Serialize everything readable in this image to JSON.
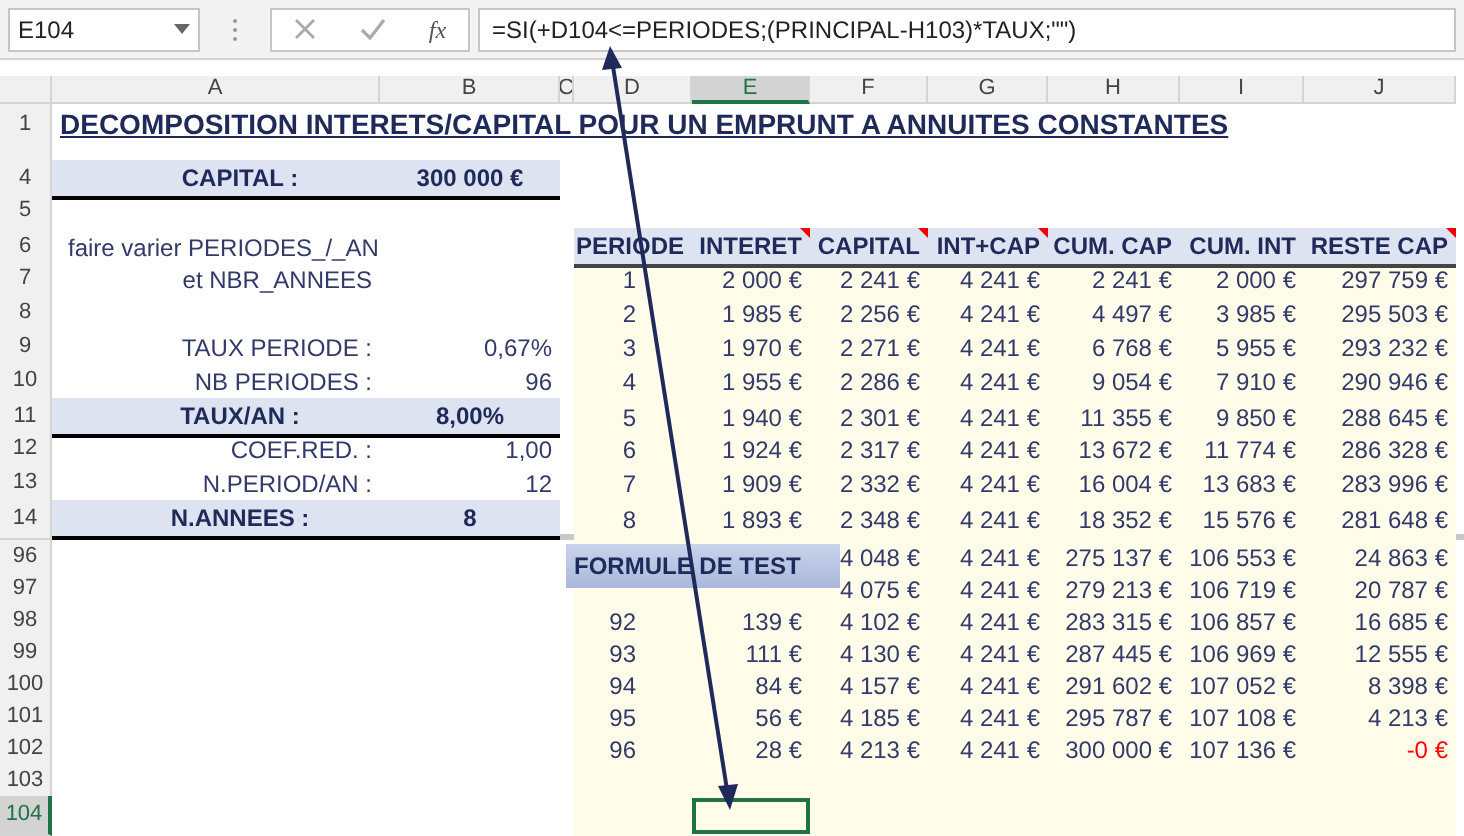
{
  "formula_bar": {
    "name_box": "E104",
    "fx_label": "fx",
    "formula": "=SI(+D104<=PERIODES;(PRINCIPAL-H103)*TAUX;\"\")"
  },
  "columns": [
    {
      "label": "A",
      "selected": false
    },
    {
      "label": "B",
      "selected": false
    },
    {
      "label": "C",
      "selected": false
    },
    {
      "label": "D",
      "selected": false
    },
    {
      "label": "E",
      "selected": true
    },
    {
      "label": "F",
      "selected": false
    },
    {
      "label": "G",
      "selected": false
    },
    {
      "label": "H",
      "selected": false
    },
    {
      "label": "I",
      "selected": false
    },
    {
      "label": "J",
      "selected": false
    }
  ],
  "title_row": {
    "number": "1",
    "text": "DECOMPOSITION INTERETS/CAPITAL POUR UN EMPRUNT A ANNUITES CONSTANTES"
  },
  "table_header": [
    {
      "label": "PERIODE",
      "comment": false
    },
    {
      "label": "INTERET",
      "comment": true
    },
    {
      "label": "CAPITAL",
      "comment": true
    },
    {
      "label": "INT+CAP",
      "comment": true
    },
    {
      "label": "CUM. CAP",
      "comment": false
    },
    {
      "label": "CUM. INT",
      "comment": false
    },
    {
      "label": "RESTE CAP",
      "comment": true
    }
  ],
  "top_rows": [
    {
      "number": "4",
      "left": {
        "kind": "band",
        "label": "CAPITAL :",
        "value": "300 000 €"
      }
    },
    {
      "number": "5",
      "kind": "empty"
    },
    {
      "number": "6",
      "left": {
        "kind": "note",
        "label": "faire varier PERIODES_/_AN"
      },
      "kind": "header"
    },
    {
      "number": "7",
      "left": {
        "kind": "plain",
        "label": "et NBR_ANNEES"
      },
      "cells": [
        "1",
        "2 000 €",
        "2 241 €",
        "4 241 €",
        "2 241 €",
        "2 000 €",
        "297 759 €"
      ]
    },
    {
      "number": "8",
      "cells": [
        "2",
        "1 985 €",
        "2 256 €",
        "4 241 €",
        "4 497 €",
        "3 985 €",
        "295 503 €"
      ]
    },
    {
      "number": "9",
      "left": {
        "kind": "plain",
        "label": "TAUX PERIODE :",
        "value": "0,67%"
      },
      "cells": [
        "3",
        "1 970 €",
        "2 271 €",
        "4 241 €",
        "6 768 €",
        "5 955 €",
        "293 232 €"
      ]
    },
    {
      "number": "10",
      "left": {
        "kind": "plain",
        "label": "NB PERIODES :",
        "value": "96"
      },
      "cells": [
        "4",
        "1 955 €",
        "2 286 €",
        "4 241 €",
        "9 054 €",
        "7 910 €",
        "290 946 €"
      ]
    },
    {
      "number": "11",
      "left": {
        "kind": "band",
        "label": "TAUX/AN :",
        "value": "8,00%"
      },
      "cells": [
        "5",
        "1 940 €",
        "2 301 €",
        "4 241 €",
        "11 355 €",
        "9 850 €",
        "288 645 €"
      ]
    },
    {
      "number": "12",
      "left": {
        "kind": "plain",
        "label": "COEF.RED. :",
        "value": "1,00"
      },
      "cells": [
        "6",
        "1 924 €",
        "2 317 €",
        "4 241 €",
        "13 672 €",
        "11 774 €",
        "286 328 €"
      ]
    },
    {
      "number": "13",
      "left": {
        "kind": "plain",
        "label": "N.PERIOD/AN :",
        "value": "12"
      },
      "cells": [
        "7",
        "1 909 €",
        "2 332 €",
        "4 241 €",
        "16 004 €",
        "13 683 €",
        "283 996 €"
      ]
    },
    {
      "number": "14",
      "left": {
        "kind": "band",
        "label": "N.ANNEES :",
        "value": "8"
      },
      "cells": [
        "8",
        "1 893 €",
        "2 348 €",
        "4 241 €",
        "18 352 €",
        "15 576 €",
        "281 648 €"
      ]
    }
  ],
  "bottom_rows": [
    {
      "number": "96",
      "selected": false,
      "cells": [
        null,
        null,
        "4 048 €",
        "4 241 €",
        "275 137 €",
        "106 553 €",
        "24 863 €"
      ]
    },
    {
      "number": "97",
      "selected": false,
      "cells": [
        null,
        null,
        "4 075 €",
        "4 241 €",
        "279 213 €",
        "106 719 €",
        "20 787 €"
      ]
    },
    {
      "number": "98",
      "selected": false,
      "cells": [
        "92",
        "139 €",
        "4 102 €",
        "4 241 €",
        "283 315 €",
        "106 857 €",
        "16 685 €"
      ]
    },
    {
      "number": "99",
      "selected": false,
      "cells": [
        "93",
        "111 €",
        "4 130 €",
        "4 241 €",
        "287 445 €",
        "106 969 €",
        "12 555 €"
      ]
    },
    {
      "number": "100",
      "selected": false,
      "cells": [
        "94",
        "84 €",
        "4 157 €",
        "4 241 €",
        "291 602 €",
        "107 052 €",
        "8 398 €"
      ]
    },
    {
      "number": "101",
      "selected": false,
      "cells": [
        "95",
        "56 €",
        "4 185 €",
        "4 241 €",
        "295 787 €",
        "107 108 €",
        "4 213 €"
      ]
    },
    {
      "number": "102",
      "selected": false,
      "negative": true,
      "cells": [
        "96",
        "28 €",
        "4 213 €",
        "4 241 €",
        "300 000 €",
        "107 136 €",
        "-0 €"
      ]
    },
    {
      "number": "103",
      "selected": false
    },
    {
      "number": "104",
      "selected": true
    }
  ],
  "overlay_label": "FORMULE DE TEST"
}
